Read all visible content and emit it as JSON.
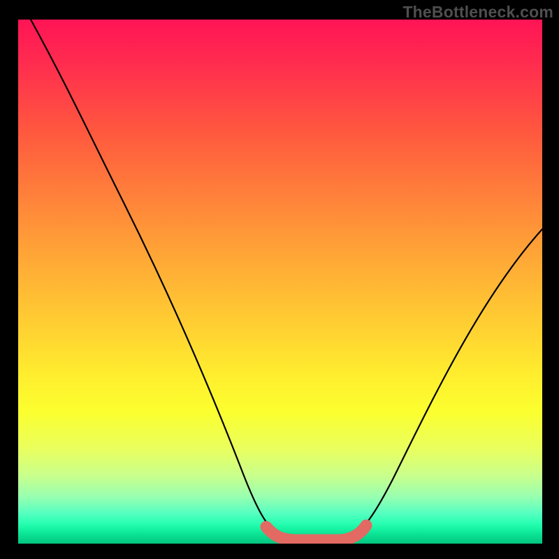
{
  "attribution": "TheBottleneck.com",
  "chart_data": {
    "type": "line",
    "title": "",
    "xlabel": "",
    "ylabel": "",
    "xlim": [
      0,
      100
    ],
    "ylim": [
      0,
      100
    ],
    "series": [
      {
        "name": "bottleneck-curve",
        "x": [
          0,
          8,
          16,
          24,
          32,
          40,
          46,
          50,
          53,
          56,
          60,
          63,
          70,
          80,
          90,
          100
        ],
        "y": [
          100,
          88,
          73,
          58,
          44,
          29,
          14,
          4,
          0,
          0,
          0,
          4,
          16,
          32,
          46,
          60
        ]
      },
      {
        "name": "optimal-zone",
        "x": [
          50,
          53,
          56,
          60,
          63
        ],
        "y": [
          4,
          0,
          0,
          0,
          4
        ]
      }
    ],
    "annotations": [],
    "grid": false,
    "legend": false
  }
}
